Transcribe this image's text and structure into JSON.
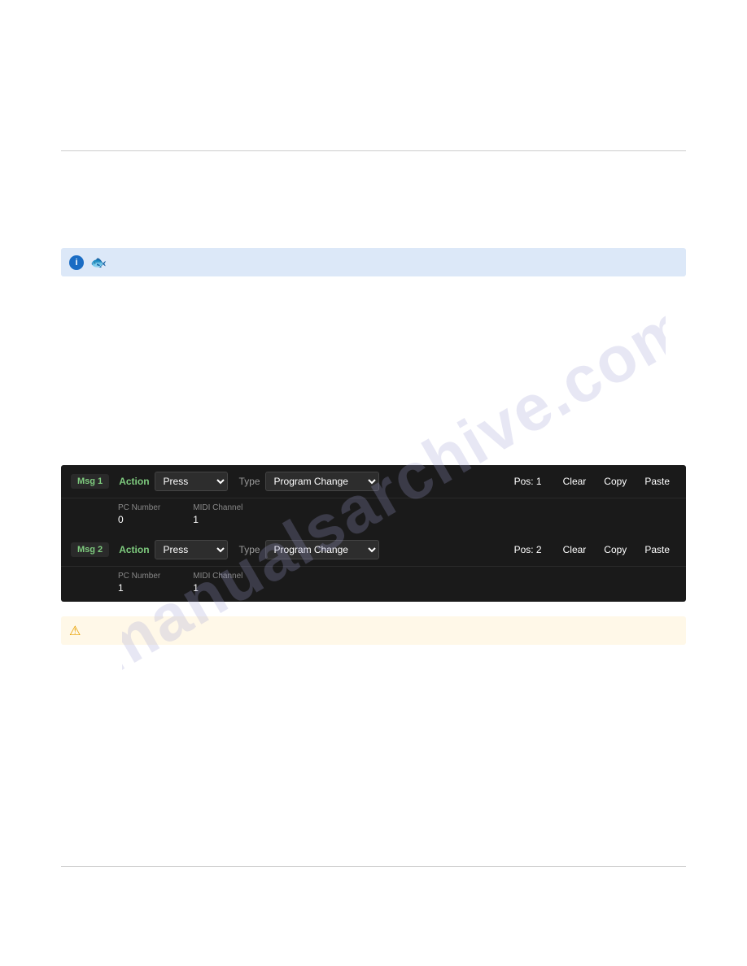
{
  "dividers": {
    "top_visible": true,
    "bottom_visible": true
  },
  "info_banner": {
    "info_icon_label": "i",
    "fish_icon": "🐟"
  },
  "watermark": {
    "text": "manualsarchive.com"
  },
  "messages": [
    {
      "id": "msg1",
      "label": "Msg 1",
      "action_label": "Action",
      "action_value": "Press",
      "type_label": "Type",
      "type_value": "Program Change",
      "pos_label": "Pos: 1",
      "clear_label": "Clear",
      "copy_label": "Copy",
      "paste_label": "Paste",
      "pc_number_label": "PC Number",
      "pc_number_value": "0",
      "midi_channel_label": "MIDI Channel",
      "midi_channel_value": "1"
    },
    {
      "id": "msg2",
      "label": "Msg 2",
      "action_label": "Action",
      "action_value": "Press",
      "type_label": "Type",
      "type_value": "Program Change",
      "pos_label": "Pos: 2",
      "clear_label": "Clear",
      "copy_label": "Copy",
      "paste_label": "Paste",
      "pc_number_label": "PC Number",
      "pc_number_value": "1",
      "midi_channel_label": "MIDI Channel",
      "midi_channel_value": "1"
    }
  ],
  "warning_banner": {
    "icon": "⚠"
  },
  "colors": {
    "accent_green": "#7ecb7e",
    "info_bg": "#dce8f8",
    "warning_bg": "#fff8e8",
    "panel_bg": "#1a1a1a",
    "warning_icon": "#e8a000"
  }
}
